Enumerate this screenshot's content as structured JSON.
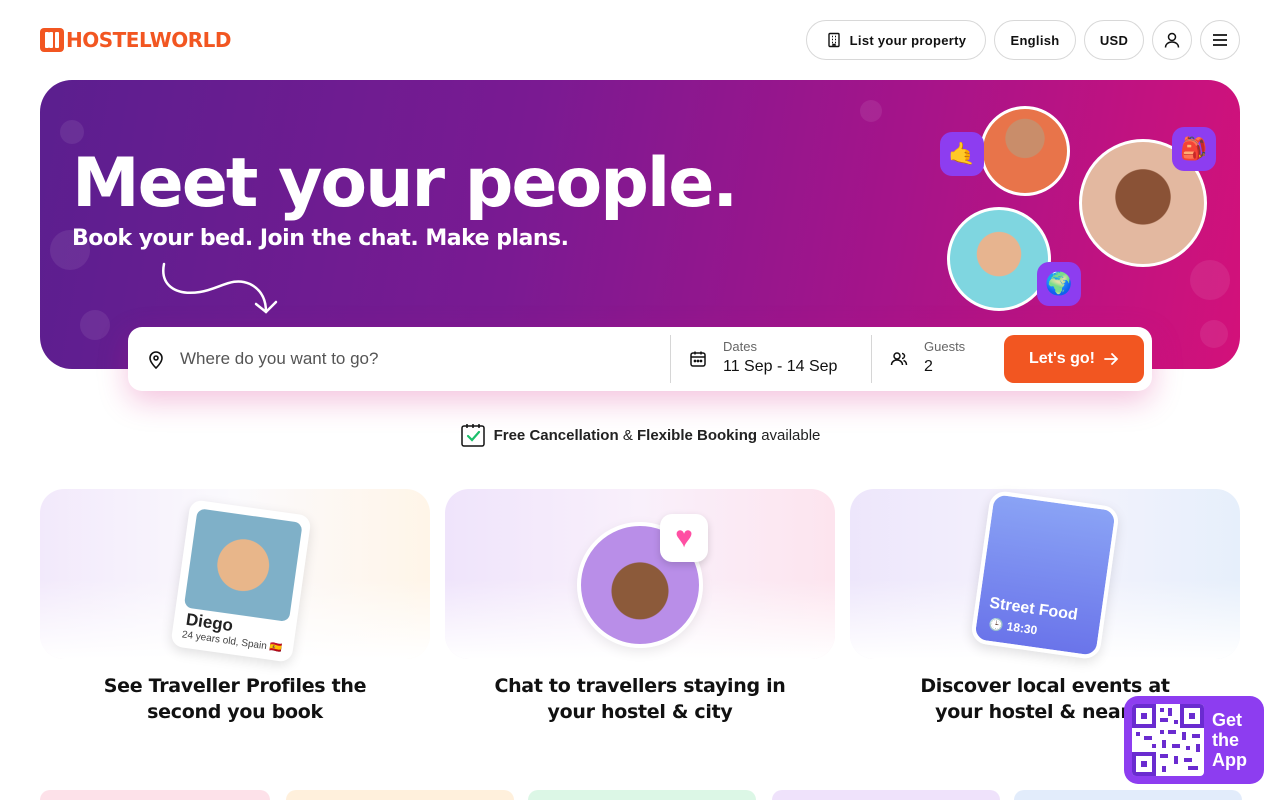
{
  "header": {
    "logo_text": "HOSTELWORLD",
    "list_property_label": "List your property",
    "language_label": "English",
    "currency_label": "USD"
  },
  "hero": {
    "title": "Meet your people.",
    "subtitle": "Book your bed. Join the chat. Make plans."
  },
  "search": {
    "destination_placeholder": "Where do you want to go?",
    "dates_label": "Dates",
    "dates_value": "11 Sep - 14 Sep",
    "guests_label": "Guests",
    "guests_value": "2",
    "submit_label": "Let's go!"
  },
  "free_cancellation": {
    "part1": "Free Cancellation",
    "joiner": "&",
    "part2": "Flexible Booking",
    "suffix": "available"
  },
  "features": [
    {
      "title_line1": "See Traveller Profiles the",
      "title_line2": "second you book",
      "card_name": "Diego",
      "card_meta": "24 years old, Spain 🇪🇸"
    },
    {
      "title_line1": "Chat to travellers staying in",
      "title_line2": "your hostel & city"
    },
    {
      "title_line1": "Discover local events at",
      "title_line2": "your hostel & nearby",
      "event_title": "Street Food",
      "event_time": "18:30"
    }
  ],
  "get_app": {
    "line1": "Get",
    "line2": "the",
    "line3": "App"
  },
  "colors": {
    "brand_orange": "#f25621",
    "brand_purple": "#8d3df0",
    "hero_gradient_start": "#5b1f8f",
    "hero_gradient_end": "#d3117a"
  }
}
